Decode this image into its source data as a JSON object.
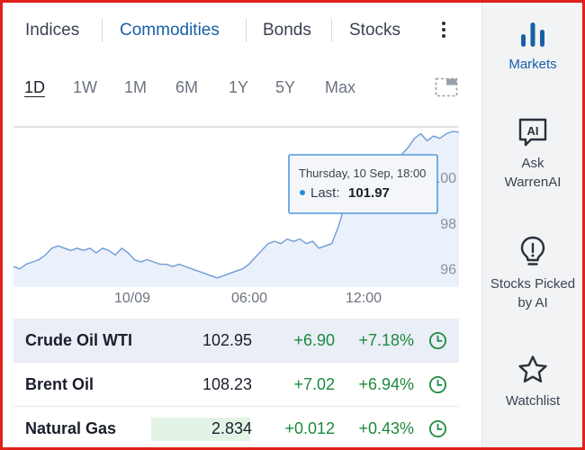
{
  "tabs": [
    {
      "label": "Indices",
      "active": false
    },
    {
      "label": "Commodities",
      "active": true
    },
    {
      "label": "Bonds",
      "active": false
    },
    {
      "label": "Stocks",
      "active": false
    }
  ],
  "ranges": [
    "1D",
    "1W",
    "1M",
    "6M",
    "1Y",
    "5Y",
    "Max"
  ],
  "active_range": "1D",
  "chart_data": {
    "type": "area",
    "x_tick_labels": [
      "10/09",
      "06:00",
      "12:00"
    ],
    "y_tick_labels": [
      "96",
      "98",
      "100"
    ],
    "ylim": [
      95.2,
      102.2
    ],
    "y_ticks": [
      96,
      98,
      100
    ],
    "series": [
      {
        "values": [
          96.1,
          96.0,
          96.2,
          96.3,
          96.4,
          96.6,
          96.9,
          97.0,
          96.9,
          96.8,
          96.9,
          96.8,
          96.9,
          96.7,
          96.9,
          96.8,
          96.6,
          96.9,
          96.7,
          96.4,
          96.3,
          96.4,
          96.3,
          96.2,
          96.2,
          96.1,
          96.2,
          96.1,
          96.0,
          95.9,
          95.8,
          95.7,
          95.6,
          95.7,
          95.8,
          95.9,
          96.0,
          96.2,
          96.5,
          96.8,
          97.1,
          97.2,
          97.1,
          97.3,
          97.2,
          97.3,
          97.1,
          97.2,
          96.9,
          97.0,
          97.1,
          97.8,
          98.7,
          99.4,
          99.5,
          99.7,
          99.9,
          100.1,
          100.2,
          100.4,
          100.7,
          101.0,
          101.3,
          101.7,
          101.9,
          101.6,
          101.8,
          101.7,
          101.9,
          102.0,
          101.97
        ]
      }
    ],
    "tooltip": {
      "date": "Thursday, 10 Sep, 18:00",
      "label": "Last:",
      "value": "101.97"
    },
    "colors": {
      "line": "#6f9bd4",
      "fill": "#eaf1fb"
    }
  },
  "rows": [
    {
      "name": "Crude Oil WTI",
      "last": "102.95",
      "change": "+6.90",
      "change_pct": "+7.18%",
      "highlight": true,
      "flash": false
    },
    {
      "name": "Brent Oil",
      "last": "108.23",
      "change": "+7.02",
      "change_pct": "+6.94%",
      "highlight": false,
      "flash": false
    },
    {
      "name": "Natural Gas",
      "last": "2.834",
      "change": "+0.012",
      "change_pct": "+0.43%",
      "highlight": false,
      "flash": true
    }
  ],
  "sidebar": [
    {
      "label": "Markets",
      "icon": "bar-chart-icon",
      "active": true
    },
    {
      "label": "Ask WarrenAI",
      "icon": "ai-chat-icon",
      "active": false
    },
    {
      "label": "Stocks Picked by AI",
      "icon": "lightbulb-icon",
      "active": false
    },
    {
      "label": "Watchlist",
      "icon": "star-icon",
      "active": false
    }
  ],
  "colors": {
    "accent": "#1760a6",
    "positive": "#1d8a3e",
    "frame": "#e0201b"
  }
}
